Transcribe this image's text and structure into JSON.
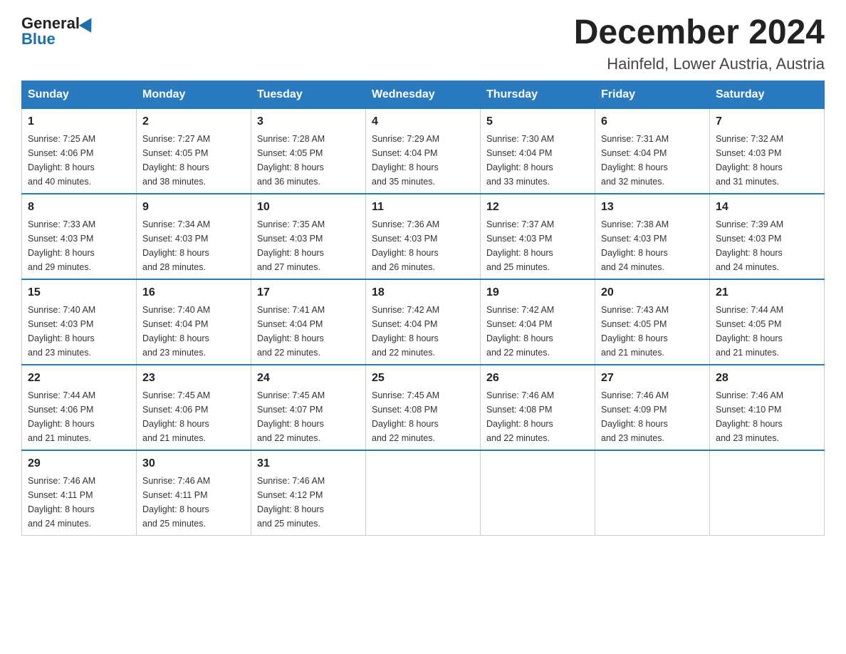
{
  "header": {
    "logo_general": "General",
    "logo_blue": "Blue",
    "month_title": "December 2024",
    "location": "Hainfeld, Lower Austria, Austria"
  },
  "weekdays": [
    "Sunday",
    "Monday",
    "Tuesday",
    "Wednesday",
    "Thursday",
    "Friday",
    "Saturday"
  ],
  "weeks": [
    [
      {
        "day": "1",
        "sunrise": "7:25 AM",
        "sunset": "4:06 PM",
        "daylight": "8 hours and 40 minutes."
      },
      {
        "day": "2",
        "sunrise": "7:27 AM",
        "sunset": "4:05 PM",
        "daylight": "8 hours and 38 minutes."
      },
      {
        "day": "3",
        "sunrise": "7:28 AM",
        "sunset": "4:05 PM",
        "daylight": "8 hours and 36 minutes."
      },
      {
        "day": "4",
        "sunrise": "7:29 AM",
        "sunset": "4:04 PM",
        "daylight": "8 hours and 35 minutes."
      },
      {
        "day": "5",
        "sunrise": "7:30 AM",
        "sunset": "4:04 PM",
        "daylight": "8 hours and 33 minutes."
      },
      {
        "day": "6",
        "sunrise": "7:31 AM",
        "sunset": "4:04 PM",
        "daylight": "8 hours and 32 minutes."
      },
      {
        "day": "7",
        "sunrise": "7:32 AM",
        "sunset": "4:03 PM",
        "daylight": "8 hours and 31 minutes."
      }
    ],
    [
      {
        "day": "8",
        "sunrise": "7:33 AM",
        "sunset": "4:03 PM",
        "daylight": "8 hours and 29 minutes."
      },
      {
        "day": "9",
        "sunrise": "7:34 AM",
        "sunset": "4:03 PM",
        "daylight": "8 hours and 28 minutes."
      },
      {
        "day": "10",
        "sunrise": "7:35 AM",
        "sunset": "4:03 PM",
        "daylight": "8 hours and 27 minutes."
      },
      {
        "day": "11",
        "sunrise": "7:36 AM",
        "sunset": "4:03 PM",
        "daylight": "8 hours and 26 minutes."
      },
      {
        "day": "12",
        "sunrise": "7:37 AM",
        "sunset": "4:03 PM",
        "daylight": "8 hours and 25 minutes."
      },
      {
        "day": "13",
        "sunrise": "7:38 AM",
        "sunset": "4:03 PM",
        "daylight": "8 hours and 24 minutes."
      },
      {
        "day": "14",
        "sunrise": "7:39 AM",
        "sunset": "4:03 PM",
        "daylight": "8 hours and 24 minutes."
      }
    ],
    [
      {
        "day": "15",
        "sunrise": "7:40 AM",
        "sunset": "4:03 PM",
        "daylight": "8 hours and 23 minutes."
      },
      {
        "day": "16",
        "sunrise": "7:40 AM",
        "sunset": "4:04 PM",
        "daylight": "8 hours and 23 minutes."
      },
      {
        "day": "17",
        "sunrise": "7:41 AM",
        "sunset": "4:04 PM",
        "daylight": "8 hours and 22 minutes."
      },
      {
        "day": "18",
        "sunrise": "7:42 AM",
        "sunset": "4:04 PM",
        "daylight": "8 hours and 22 minutes."
      },
      {
        "day": "19",
        "sunrise": "7:42 AM",
        "sunset": "4:04 PM",
        "daylight": "8 hours and 22 minutes."
      },
      {
        "day": "20",
        "sunrise": "7:43 AM",
        "sunset": "4:05 PM",
        "daylight": "8 hours and 21 minutes."
      },
      {
        "day": "21",
        "sunrise": "7:44 AM",
        "sunset": "4:05 PM",
        "daylight": "8 hours and 21 minutes."
      }
    ],
    [
      {
        "day": "22",
        "sunrise": "7:44 AM",
        "sunset": "4:06 PM",
        "daylight": "8 hours and 21 minutes."
      },
      {
        "day": "23",
        "sunrise": "7:45 AM",
        "sunset": "4:06 PM",
        "daylight": "8 hours and 21 minutes."
      },
      {
        "day": "24",
        "sunrise": "7:45 AM",
        "sunset": "4:07 PM",
        "daylight": "8 hours and 22 minutes."
      },
      {
        "day": "25",
        "sunrise": "7:45 AM",
        "sunset": "4:08 PM",
        "daylight": "8 hours and 22 minutes."
      },
      {
        "day": "26",
        "sunrise": "7:46 AM",
        "sunset": "4:08 PM",
        "daylight": "8 hours and 22 minutes."
      },
      {
        "day": "27",
        "sunrise": "7:46 AM",
        "sunset": "4:09 PM",
        "daylight": "8 hours and 23 minutes."
      },
      {
        "day": "28",
        "sunrise": "7:46 AM",
        "sunset": "4:10 PM",
        "daylight": "8 hours and 23 minutes."
      }
    ],
    [
      {
        "day": "29",
        "sunrise": "7:46 AM",
        "sunset": "4:11 PM",
        "daylight": "8 hours and 24 minutes."
      },
      {
        "day": "30",
        "sunrise": "7:46 AM",
        "sunset": "4:11 PM",
        "daylight": "8 hours and 25 minutes."
      },
      {
        "day": "31",
        "sunrise": "7:46 AM",
        "sunset": "4:12 PM",
        "daylight": "8 hours and 25 minutes."
      },
      null,
      null,
      null,
      null
    ]
  ],
  "labels": {
    "sunrise": "Sunrise:",
    "sunset": "Sunset:",
    "daylight": "Daylight:"
  }
}
